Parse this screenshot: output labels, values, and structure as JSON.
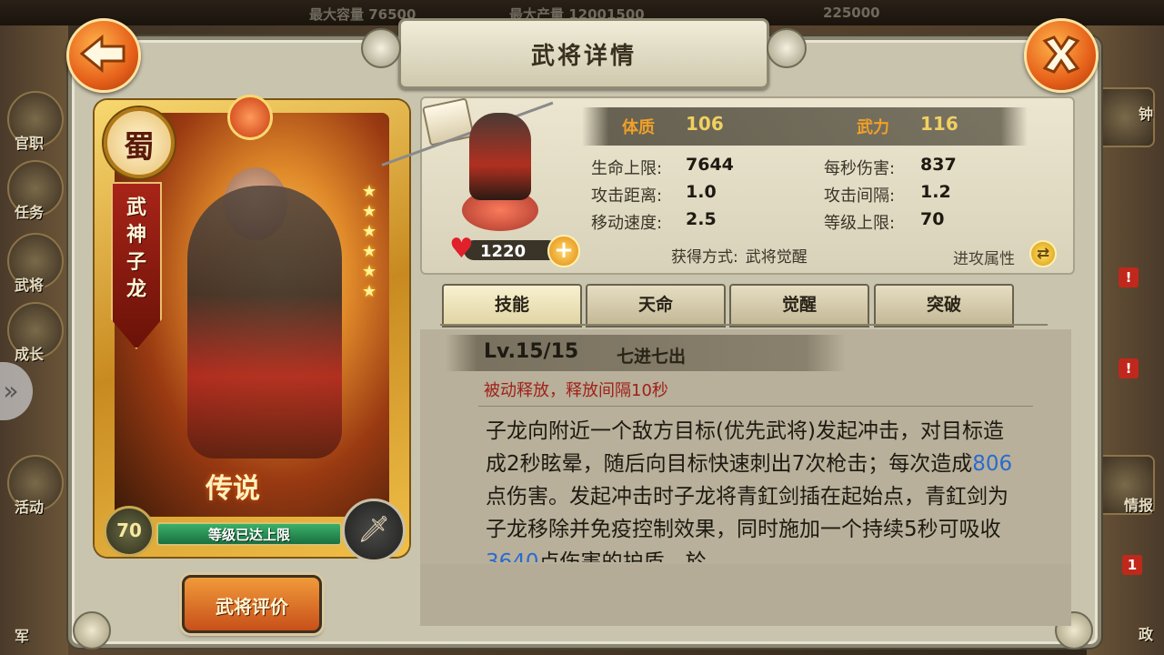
{
  "background": {
    "top_stats": [
      {
        "label": "最大容量",
        "value": "76500"
      },
      {
        "label": "最大产量",
        "value": "12001500"
      },
      {
        "label": "",
        "value": "225000"
      }
    ],
    "left_menu": [
      "官职",
      "任务",
      "武将",
      "成长",
      "活动",
      "军"
    ],
    "right_menu": [
      "钟",
      "情报",
      "政"
    ],
    "badges": [
      "!",
      "!",
      "1"
    ]
  },
  "header": {
    "title": "武将详情",
    "back_icon": "back-arrow-icon",
    "close_icon": "close-x-icon"
  },
  "card": {
    "faction": "蜀",
    "name_chars": [
      "武",
      "神",
      "子",
      "龙"
    ],
    "rarity_label": "传说",
    "level": "70",
    "level_status": "等级已达上限",
    "stars": 6
  },
  "evaluate_button": "武将评价",
  "stats": {
    "top": [
      {
        "key": "体质",
        "value": "106"
      },
      {
        "key": "武力",
        "value": "116"
      }
    ],
    "left": [
      {
        "key": "生命上限:",
        "value": "7644"
      },
      {
        "key": "攻击距离:",
        "value": "1.0"
      },
      {
        "key": "移动速度:",
        "value": "2.5"
      }
    ],
    "right": [
      {
        "key": "每秒伤害:",
        "value": "837"
      },
      {
        "key": "攻击间隔:",
        "value": "1.2"
      },
      {
        "key": "等级上限:",
        "value": "70"
      }
    ],
    "hp_value": "1220",
    "obtain_label": "获得方式:",
    "obtain_value": "武将觉醒",
    "attr_toggle": "进攻属性"
  },
  "tabs": [
    "技能",
    "天命",
    "觉醒",
    "突破"
  ],
  "skill": {
    "level": "Lv.15/15",
    "name": "七进七出",
    "trigger": "被动释放，释放间隔10秒",
    "desc_parts": [
      {
        "text": "子龙向附近一个敌方目标(优先武将)发起冲击，对目标造成2秒眩晕，随后向目标快速刺出7次枪击；每次造成",
        "num": false
      },
      {
        "text": "806",
        "num": true
      },
      {
        "text": "点伤害。发起冲击时子龙将青釭剑插在起始点，青釭剑为子龙移除并免疫控制效果，同时施加一个持续5秒可吸收",
        "num": false
      },
      {
        "text": "3640",
        "num": true
      },
      {
        "text": "点伤害的护盾，於",
        "num": false
      }
    ]
  }
}
